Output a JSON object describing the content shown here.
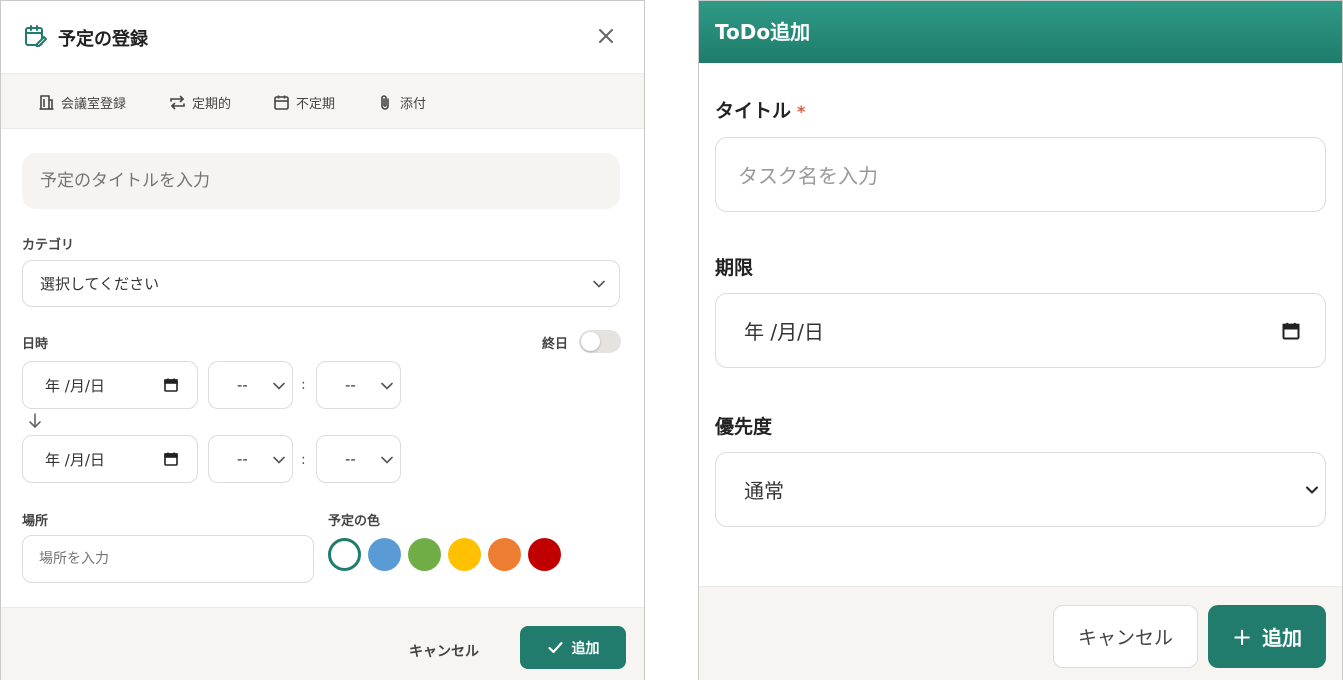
{
  "left_dialog": {
    "title": "予定の登録",
    "toolbar": {
      "room": "会議室登録",
      "recurring": "定期的",
      "irregular": "不定期",
      "attach": "添付"
    },
    "title_placeholder": "予定のタイトルを入力",
    "category_label": "カテゴリ",
    "category_value": "選択してください",
    "datetime_label": "日時",
    "allday_label": "終日",
    "allday_on": false,
    "start_date": "年 /月/日",
    "end_date": "年 /月/日",
    "time_value": "--",
    "time_sep": ":",
    "place_label": "場所",
    "place_placeholder": "場所を入力",
    "color_label": "予定の色",
    "colors": [
      "#ffffff",
      "#5b9bd5",
      "#70ad47",
      "#ffc000",
      "#ed7d31",
      "#c00000"
    ],
    "selected_color_index": 0,
    "cancel": "キャンセル",
    "add": "追加"
  },
  "right_dialog": {
    "title": "ToDo追加",
    "title_label": "タイトル",
    "required_mark": "*",
    "title_placeholder": "タスク名を入力",
    "due_label": "期限",
    "due_value": "年 /月/日",
    "priority_label": "優先度",
    "priority_value": "通常",
    "cancel": "キャンセル",
    "add": "追加",
    "add_prefix": "+"
  },
  "accent_color": "#217c6d"
}
